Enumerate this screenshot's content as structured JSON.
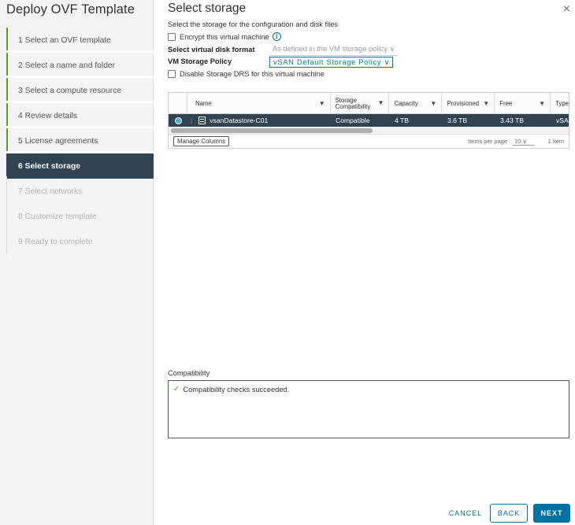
{
  "wizard": {
    "title": "Deploy OVF Template",
    "steps": [
      {
        "label": "1  Select an OVF template",
        "state": "done"
      },
      {
        "label": "2  Select a name and folder",
        "state": "done"
      },
      {
        "label": "3  Select a compute resource",
        "state": "done"
      },
      {
        "label": "4  Review details",
        "state": "done"
      },
      {
        "label": "5  License agreements",
        "state": "done"
      },
      {
        "label": "6  Select storage",
        "state": "active"
      },
      {
        "label": "7  Select networks",
        "state": "pending"
      },
      {
        "label": "8  Customize template",
        "state": "pending"
      },
      {
        "label": "9  Ready to complete",
        "state": "pending"
      }
    ]
  },
  "page": {
    "title": "Select storage",
    "description": "Select the storage for the configuration and disk files",
    "encrypt_label": "Encrypt this virtual machine",
    "disk_format_label": "Select virtual disk format",
    "disk_format_value": "As defined in the VM storage policy ∨",
    "policy_label": "VM Storage Policy",
    "policy_value": "vSAN Default Storage Policy ∨",
    "disable_drs_label": "Disable Storage DRS for this virtual machine"
  },
  "table": {
    "columns": [
      "Name",
      "Storage Compatibility",
      "Capacity",
      "Provisioned",
      "Free",
      "Type"
    ],
    "row": {
      "name": "vsanDatastore-C01",
      "compatibility": "Compatible",
      "capacity": "4 TB",
      "provisioned": "3.6 TB",
      "free": "3.43 TB",
      "type": "vSA"
    },
    "manage_columns_label": "Manage Columns",
    "items_per_page_label": "Items per page",
    "items_per_page_value": "10  ∨",
    "items_count": "1 item"
  },
  "compatibility": {
    "label": "Compatibility",
    "message": "Compatibility checks succeeded."
  },
  "footer": {
    "cancel": "CANCEL",
    "back": "BACK",
    "next": "NEXT"
  },
  "colors": {
    "accent": "#0072a3",
    "active_step_bg": "#314351",
    "done_step_bar": "#5aa220"
  }
}
